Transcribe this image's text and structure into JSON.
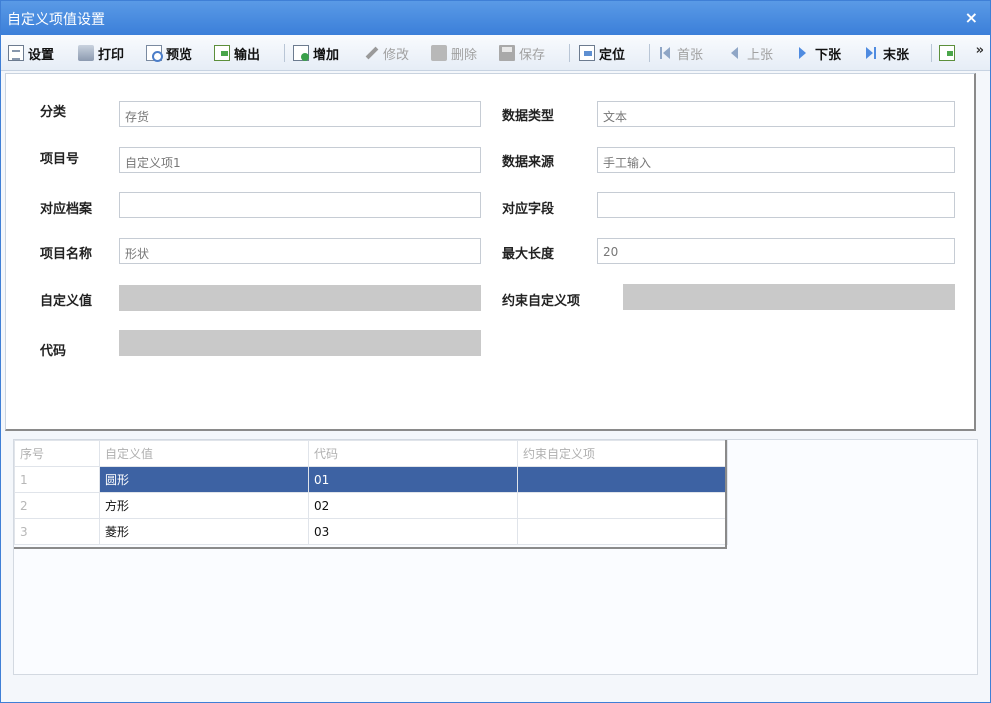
{
  "window": {
    "title": "自定义项值设置",
    "close_glyph": "×"
  },
  "toolbar": {
    "settings": "设置",
    "print": "打印",
    "preview": "预览",
    "export": "输出",
    "add": "增加",
    "edit": "修改",
    "delete": "删除",
    "save": "保存",
    "locate": "定位",
    "first": "首张",
    "prev": "上张",
    "next": "下张",
    "last": "末张",
    "more": "»"
  },
  "form": {
    "category": {
      "label": "分类",
      "value": "存货"
    },
    "data_type": {
      "label": "数据类型",
      "value": "文本"
    },
    "item_no": {
      "label": "项目号",
      "value": "自定义项1"
    },
    "data_source": {
      "label": "数据来源",
      "value": "手工输入"
    },
    "archive": {
      "label": "对应档案",
      "value": ""
    },
    "field": {
      "label": "对应字段",
      "value": ""
    },
    "item_name": {
      "label": "项目名称",
      "value": "形状"
    },
    "max_length": {
      "label": "最大长度",
      "value": "20"
    },
    "custom_value": {
      "label": "自定义值",
      "value": ""
    },
    "constraint": {
      "label": "约束自定义项",
      "value": ""
    },
    "code": {
      "label": "代码",
      "value": ""
    }
  },
  "grid": {
    "columns": [
      "序号",
      "自定义值",
      "代码",
      "约束自定义项"
    ],
    "rows": [
      {
        "seq": "1",
        "value": "圆形",
        "code": "01",
        "constraint": ""
      },
      {
        "seq": "2",
        "value": "方形",
        "code": "02",
        "constraint": ""
      },
      {
        "seq": "3",
        "value": "菱形",
        "code": "03",
        "constraint": ""
      }
    ],
    "selected_index": 0
  },
  "colors": {
    "title_bar": "#3b7fd9",
    "selection": "#3d62a3"
  }
}
